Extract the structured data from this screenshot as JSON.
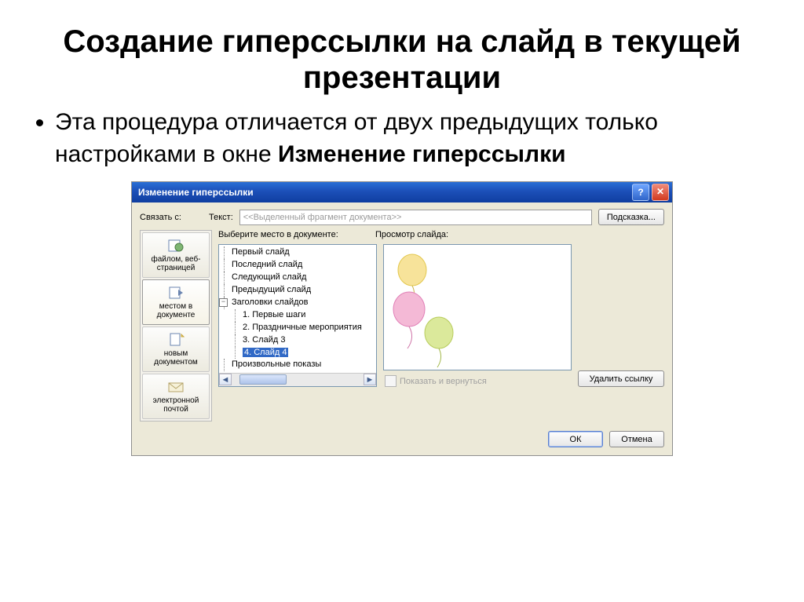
{
  "slide": {
    "title": "Создание гиперссылки на слайд в текущей презентации",
    "bullet_prefix": "Эта процедура отличается от двух предыдущих только настройками в окне ",
    "bullet_bold": "Изменение гиперссылки"
  },
  "dialog": {
    "title": "Изменение гиперссылки",
    "link_with_label": "Связать с:",
    "text_label": "Текст:",
    "text_value": "<<Выделенный фрагмент документа>>",
    "hint_button": "Подсказка...",
    "sidebar": [
      {
        "label": "файлом, веб-страницей",
        "selected": false,
        "icon": "file-web-icon"
      },
      {
        "label": "местом в документе",
        "selected": true,
        "icon": "place-in-doc-icon"
      },
      {
        "label": "новым документом",
        "selected": false,
        "icon": "new-doc-icon"
      },
      {
        "label": "электронной почтой",
        "selected": false,
        "icon": "email-icon"
      }
    ],
    "select_place_label": "Выберите место в документе:",
    "preview_label": "Просмотр слайда:",
    "tree": {
      "items": [
        "Первый слайд",
        "Последний слайд",
        "Следующий слайд",
        "Предыдущий слайд"
      ],
      "titles_group": "Заголовки слайдов",
      "titles": [
        "1. Первые шаги",
        "2. Праздничные мероприятия",
        "3. Слайд 3",
        "4. Слайд 4"
      ],
      "selected": "4. Слайд 4",
      "custom_shows": "Произвольные показы"
    },
    "show_and_return": "Показать и вернуться",
    "remove_link": "Удалить ссылку",
    "ok": "ОК",
    "cancel": "Отмена"
  }
}
